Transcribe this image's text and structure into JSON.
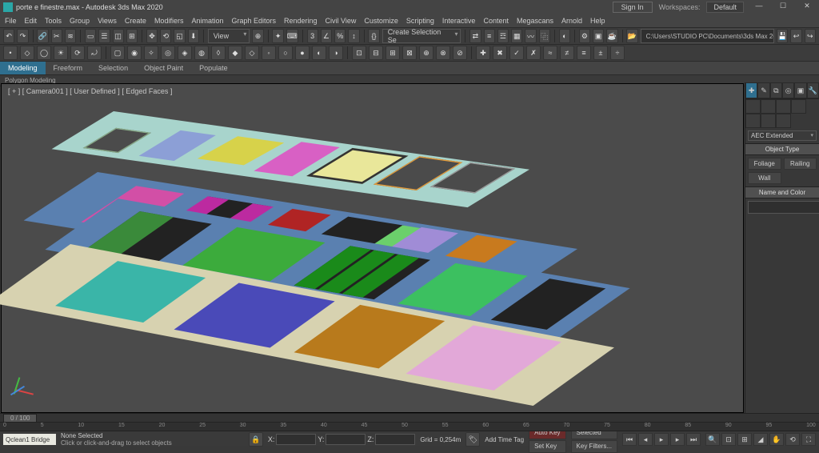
{
  "app": {
    "title": "porte e finestre.max - Autodesk 3ds Max 2020",
    "sign_in": "Sign In",
    "workspace_label": "Workspaces:",
    "workspace_value": "Default"
  },
  "menu": [
    "File",
    "Edit",
    "Tools",
    "Group",
    "Views",
    "Create",
    "Modifiers",
    "Animation",
    "Graph Editors",
    "Rendering",
    "Civil View",
    "Customize",
    "Scripting",
    "Interactive",
    "Content",
    "Megascans",
    "Arnold",
    "Help"
  ],
  "toolbar1": {
    "selection_set": "Create Selection Se",
    "recent_path": "C:\\Users\\STUDIO PC\\Documents\\3ds Max 2020"
  },
  "ribbon": {
    "tabs": [
      "Modeling",
      "Freeform",
      "Selection",
      "Object Paint",
      "Populate"
    ],
    "sub": "Polygon Modeling"
  },
  "viewport": {
    "label": "[ + ] [ Camera001 ] [ User Defined ] [ Edged Faces ]"
  },
  "cmdpanel": {
    "category": "AEC Extended",
    "rollout1": "Object Type",
    "buttons": [
      "Foliage",
      "Railing",
      "Wall"
    ],
    "rollout2": "Name and Color",
    "swatch": "#d6447a"
  },
  "status": {
    "script": "Qclean1  Bridge",
    "selection": "None Selected",
    "hint": "Click or click-and-drag to select objects",
    "add_time_tag": "Add Time Tag",
    "x": "",
    "y": "",
    "z": "",
    "grid": "Grid = 0,254m",
    "auto_key": "Auto Key",
    "set_key": "Set Key",
    "selected": "Selected",
    "key_filters": "Key Filters..."
  },
  "timeslider": {
    "pos": "0 / 100"
  },
  "ticks": [
    "0",
    "5",
    "10",
    "15",
    "20",
    "25",
    "30",
    "35",
    "40",
    "45",
    "50",
    "55",
    "60",
    "65",
    "70",
    "75",
    "80",
    "85",
    "90",
    "95",
    "100"
  ]
}
